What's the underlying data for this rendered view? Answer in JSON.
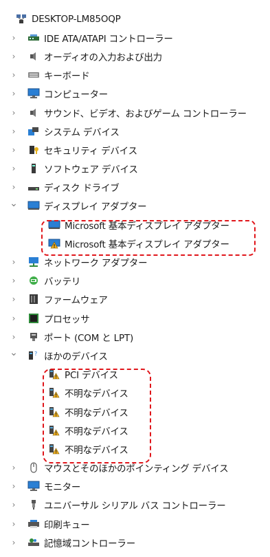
{
  "tree": {
    "root": {
      "label": "DESKTOP-LM85OQP",
      "icon": "computer-network-icon"
    },
    "items": [
      {
        "label": "IDE ATA/ATAPI コントローラー",
        "icon": "ide-controller-icon",
        "expanded": false
      },
      {
        "label": "オーディオの入力および出力",
        "icon": "speaker-icon",
        "expanded": false
      },
      {
        "label": "キーボード",
        "icon": "keyboard-icon",
        "expanded": false
      },
      {
        "label": "コンピューター",
        "icon": "monitor-icon",
        "expanded": false
      },
      {
        "label": "サウンド、ビデオ、およびゲーム コントローラー",
        "icon": "speaker-icon",
        "expanded": false
      },
      {
        "label": "システム デバイス",
        "icon": "system-device-icon",
        "expanded": false
      },
      {
        "label": "セキュリティ デバイス",
        "icon": "security-device-icon",
        "expanded": false
      },
      {
        "label": "ソフトウェア デバイス",
        "icon": "software-device-icon",
        "expanded": false
      },
      {
        "label": "ディスク ドライブ",
        "icon": "disk-drive-icon",
        "expanded": false
      },
      {
        "label": "ディスプレイ アダプター",
        "icon": "display-adapter-icon",
        "expanded": true
      },
      {
        "label": "Microsoft 基本ディスプレイ アダプター",
        "icon": "display-adapter-icon",
        "child": true
      },
      {
        "label": "Microsoft 基本ディスプレイ アダプター",
        "icon": "display-adapter-warning-icon",
        "child": true
      },
      {
        "label": "ネットワーク アダプター",
        "icon": "network-adapter-icon",
        "expanded": false
      },
      {
        "label": "バッテリ",
        "icon": "battery-icon",
        "expanded": false
      },
      {
        "label": "ファームウェア",
        "icon": "firmware-icon",
        "expanded": false
      },
      {
        "label": "プロセッサ",
        "icon": "processor-icon",
        "expanded": false
      },
      {
        "label": "ポート (COM と LPT)",
        "icon": "port-icon",
        "expanded": false
      },
      {
        "label": "ほかのデバイス",
        "icon": "other-devices-icon",
        "expanded": true
      },
      {
        "label": "PCI デバイス",
        "icon": "unknown-device-warning-icon",
        "child": true
      },
      {
        "label": "不明なデバイス",
        "icon": "unknown-device-warning-icon",
        "child": true
      },
      {
        "label": "不明なデバイス",
        "icon": "unknown-device-warning-icon",
        "child": true
      },
      {
        "label": "不明なデバイス",
        "icon": "unknown-device-warning-icon",
        "child": true
      },
      {
        "label": "不明なデバイス",
        "icon": "unknown-device-warning-icon",
        "child": true
      },
      {
        "label": "マウスとそのほかのポインティング デバイス",
        "icon": "mouse-icon",
        "expanded": false
      },
      {
        "label": "モニター",
        "icon": "monitor-icon",
        "expanded": false
      },
      {
        "label": "ユニバーサル シリアル バス コントローラー",
        "icon": "usb-icon",
        "expanded": false
      },
      {
        "label": "印刷キュー",
        "icon": "printer-icon",
        "expanded": false
      },
      {
        "label": "記憶域コントローラー",
        "icon": "storage-controller-icon",
        "expanded": false
      }
    ]
  },
  "colors": {
    "highlight_dash": "#e0151a",
    "warning": "#f2b01e",
    "monitor_blue": "#2a7fd4"
  }
}
